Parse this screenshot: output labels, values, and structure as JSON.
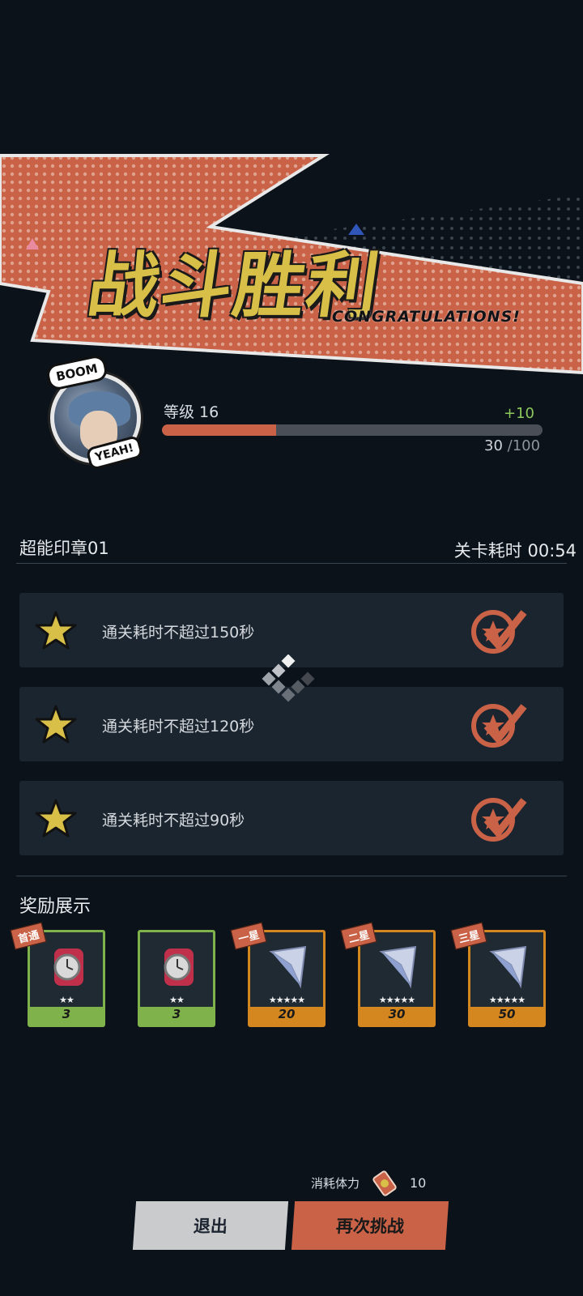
{
  "banner": {
    "title": "战斗胜利",
    "subtitle": "CONGRATULATIONS!",
    "colors": {
      "accent": "#c96247",
      "title": "#d8bf47"
    }
  },
  "player": {
    "boom_text": "BOOM",
    "yeah_text": "YEAH!",
    "level_label": "等级 16",
    "level_gain": "+10",
    "xp_current": "30",
    "xp_max": "/100",
    "xp_progress": 0.3
  },
  "stage": {
    "name": "超能印章01",
    "time": "关卡耗时 00:54"
  },
  "objectives": [
    {
      "text": "通关耗时不超过150秒",
      "icon": "star-icon",
      "status_icon": "check-badge-icon"
    },
    {
      "text": "通关耗时不超过120秒",
      "icon": "star-icon",
      "status_icon": "check-badge-icon"
    },
    {
      "text": "通关耗时不超过90秒",
      "icon": "star-icon",
      "status_icon": "check-badge-icon"
    }
  ],
  "rewards": {
    "title": "奖励展示",
    "items": [
      {
        "tag": "首通",
        "rarity": "★★",
        "count": "3",
        "icon": "watch-icon",
        "frame": "green"
      },
      {
        "tag": "",
        "rarity": "★★",
        "count": "3",
        "icon": "watch-icon",
        "frame": "green"
      },
      {
        "tag": "一星",
        "rarity": "★★★★★",
        "count": "20",
        "icon": "crystal-icon",
        "frame": "orange"
      },
      {
        "tag": "二星",
        "rarity": "★★★★★",
        "count": "30",
        "icon": "crystal-icon",
        "frame": "orange"
      },
      {
        "tag": "三星",
        "rarity": "★★★★★",
        "count": "50",
        "icon": "crystal-icon",
        "frame": "orange"
      }
    ]
  },
  "footer": {
    "cost_label": "消耗体力",
    "cost_value": "10",
    "exit_label": "退出",
    "retry_label": "再次挑战"
  }
}
